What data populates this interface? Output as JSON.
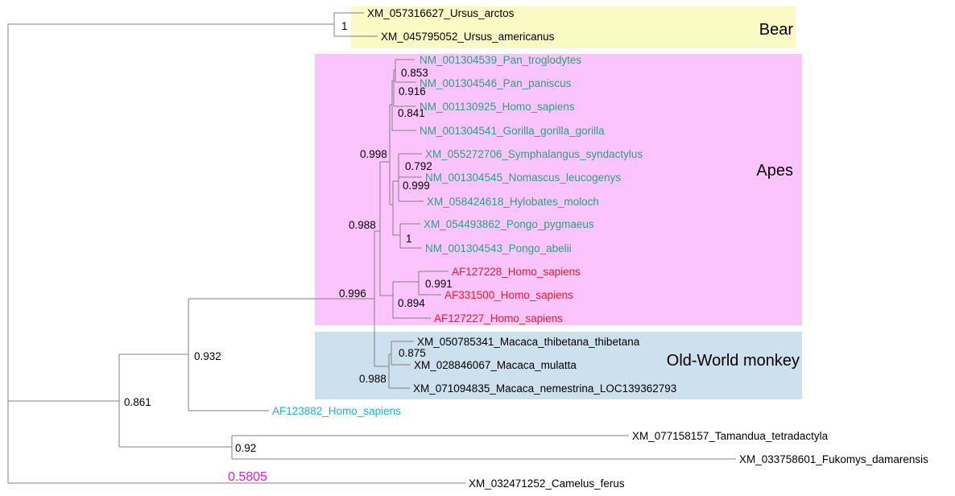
{
  "colors": {
    "bear_box": "#fafac4",
    "apes_box": "#fcc4fc",
    "monkey_box": "#cde0ee",
    "green_tip": "#2aa27a",
    "red_tip": "#ee1c24",
    "cyan_tip": "#1fb0d8",
    "black_tip": "#000000",
    "scale": "#e020c8",
    "branch": "#7f7f7f"
  },
  "groups": {
    "bear": "Bear",
    "apes": "Apes",
    "monkey": "Old-World monkey"
  },
  "tips": [
    "XM_057316627_Ursus_arctos",
    "XM_045795052_Ursus_americanus",
    "NM_001304539_Pan_troglodytes",
    "NM_001304546_Pan_paniscus",
    "NM_001130925_Homo_sapiens",
    "NM_001304541_Gorilla_gorilla_gorilla",
    "XM_055272706_Symphalangus_syndactylus",
    "NM_001304545_Nomascus_leucogenys",
    "XM_058424618_Hylobates_moloch",
    "XM_054493862_Pongo_pygmaeus",
    "NM_001304543_Pongo_abelii",
    "AF127228_Homo_sapiens",
    "AF331500_Homo_sapiens",
    "AF127227_Homo_sapiens",
    "XM_050785341_Macaca_thibetana_thibetana",
    "XM_028846067_Macaca_mulatta",
    "XM_071094835_Macaca_nemestrina_LOC139362793",
    "AF123882_Homo_sapiens",
    "XM_077158157_Tamandua_tetradactyla",
    "XM_033758601_Fukomys_damarensis",
    "XM_032471252_Camelus_ferus"
  ],
  "supports": [
    "1",
    "0.853",
    "0.916",
    "0.841",
    "0.998",
    "0.792",
    "0.999",
    "1",
    "0.988",
    "0.991",
    "0.894",
    "0.996",
    "0.875",
    "0.988",
    "0.932",
    "0.861",
    "0.92"
  ],
  "scale_label": "0.5805"
}
